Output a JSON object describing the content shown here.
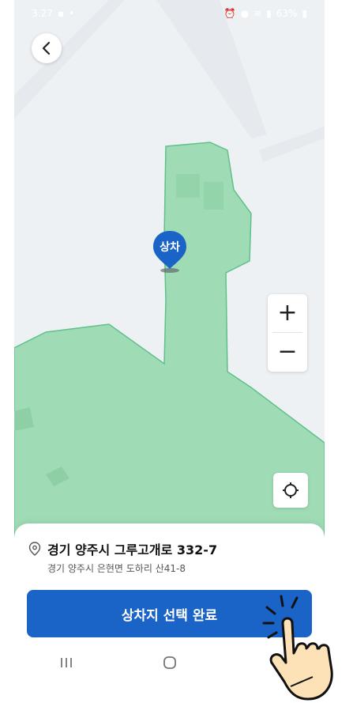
{
  "statusbar": {
    "time": "3:27",
    "battery": "63%"
  },
  "map": {
    "region_color": "#9fdcb5",
    "region_stroke": "#5fc08a",
    "background_color": "#eef1f4"
  },
  "pin": {
    "label": "상차",
    "color": "#1a63c7"
  },
  "zoom": {
    "in_label": "+",
    "out_label": "−"
  },
  "address": {
    "main": "경기 양주시 그루고개로 332-7",
    "sub": "경기 양주시 은현면 도하리 산41-8"
  },
  "confirm_button": {
    "label": "상차지 선택 완료",
    "color": "#1a63c7"
  },
  "icons": {
    "back": "chevron-left-icon",
    "location": "location-pin-icon",
    "locate": "crosshair-icon",
    "nav_recent": "recent-apps-icon",
    "nav_home": "home-icon",
    "nav_back": "back-icon"
  }
}
